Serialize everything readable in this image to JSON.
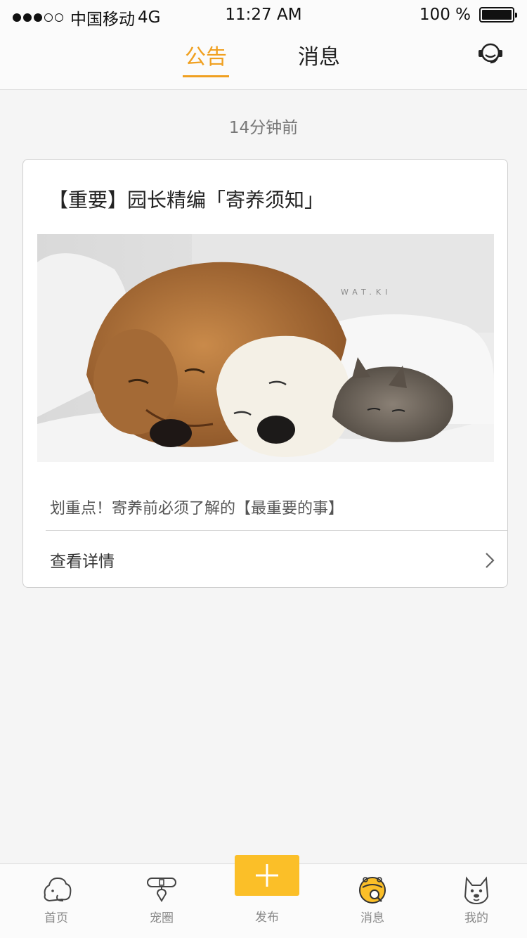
{
  "status_bar": {
    "carrier": "中国移动",
    "network": "4G",
    "time": "11:27 AM",
    "battery": "100 %",
    "signal_bars": 3
  },
  "header": {
    "tabs": [
      {
        "label": "公告",
        "active": true
      },
      {
        "label": "消息",
        "active": false
      }
    ],
    "service_icon": "customer-service-headset-icon"
  },
  "feed": {
    "timestamp": "14分钟前",
    "card": {
      "title": "【重要】园长精编「寄养须知」",
      "image_watermark": "WAT.KI",
      "description": "划重点！寄养前必须了解的【最重要的事】",
      "detail_label": "查看详情"
    }
  },
  "tabbar": {
    "items": [
      {
        "label": "首页",
        "icon": "home-pet-icon",
        "active": false
      },
      {
        "label": "宠圈",
        "icon": "pet-collar-icon",
        "active": false
      },
      {
        "label": "发布",
        "icon": "plus-icon",
        "active": false
      },
      {
        "label": "消息",
        "icon": "bell-icon",
        "active": true
      },
      {
        "label": "我的",
        "icon": "dog-face-icon",
        "active": false
      }
    ]
  },
  "colors": {
    "accent": "#f0a020",
    "publish_button": "#fbbf28",
    "background": "#f5f5f5"
  }
}
